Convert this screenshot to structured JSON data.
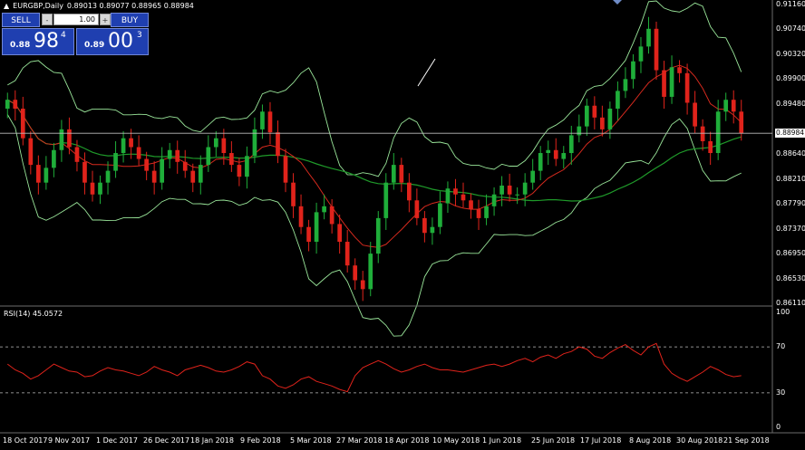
{
  "header": {
    "symbol": "EURGBP,Daily",
    "ohlc": "0.89013 0.89077 0.88965 0.88984"
  },
  "trade_panel": {
    "sell_label": "SELL",
    "buy_label": "BUY",
    "lot_value": "1.00",
    "minus_label": "-",
    "plus_label": "+",
    "sell_quote": {
      "prefix": "0.88",
      "big": "98",
      "sup": "4"
    },
    "buy_quote": {
      "prefix": "0.89",
      "big": "00",
      "sup": "3"
    }
  },
  "current_price": "0.88984",
  "price_axis": [
    "0.91160",
    "0.90740",
    "0.90320",
    "0.89900",
    "0.89480",
    "0.88640",
    "0.88210",
    "0.87790",
    "0.87370",
    "0.86950",
    "0.86530",
    "0.86110"
  ],
  "rsi": {
    "title": "RSI(14) 45.0572",
    "axis": [
      "100",
      "70",
      "30",
      "0"
    ],
    "levels": [
      70,
      30
    ]
  },
  "time_axis": [
    "18 Oct 2017",
    "9 Nov 2017",
    "1 Dec 2017",
    "26 Dec 2017",
    "18 Jan 2018",
    "9 Feb 2018",
    "5 Mar 2018",
    "27 Mar 2018",
    "18 Apr 2018",
    "10 May 2018",
    "1 Jun 2018",
    "25 Jun 2018",
    "17 Jul 2018",
    "8 Aug 2018",
    "30 Aug 2018",
    "21 Sep 2018"
  ],
  "colors": {
    "background": "#000000",
    "bull_candle": "#1fae3a",
    "bear_candle": "#e0231b",
    "bands": "#9ae69a",
    "ma_slow": "#1f9b2a",
    "ma_fast": "#d62a1e",
    "rsi_line": "#e0231b",
    "grid_line": "#bdbdbd"
  },
  "chart_data": {
    "type": "line",
    "title": "EURGBP,Daily",
    "ylim": [
      0.8611,
      0.9116
    ],
    "series": [
      {
        "name": "EURGBP",
        "values": [
          0.8955,
          0.894,
          0.889,
          0.8845,
          0.8815,
          0.884,
          0.887,
          0.8905,
          0.8875,
          0.885,
          0.8815,
          0.8795,
          0.8815,
          0.8835,
          0.8865,
          0.889,
          0.8875,
          0.8855,
          0.8835,
          0.8815,
          0.8855,
          0.887,
          0.885,
          0.8835,
          0.8815,
          0.8845,
          0.8875,
          0.889,
          0.8865,
          0.8845,
          0.8825,
          0.886,
          0.8905,
          0.8935,
          0.89,
          0.886,
          0.8815,
          0.8775,
          0.874,
          0.8715,
          0.8765,
          0.8775,
          0.8745,
          0.8715,
          0.8675,
          0.865,
          0.8635,
          0.8695,
          0.8755,
          0.8815,
          0.8845,
          0.8815,
          0.8785,
          0.8755,
          0.873,
          0.874,
          0.878,
          0.8805,
          0.8795,
          0.8785,
          0.877,
          0.8755,
          0.8775,
          0.8795,
          0.881,
          0.8795,
          0.8795,
          0.8815,
          0.8835,
          0.8865,
          0.887,
          0.8855,
          0.8865,
          0.8895,
          0.891,
          0.8945,
          0.8925,
          0.8905,
          0.894,
          0.897,
          0.899,
          0.902,
          0.9045,
          0.9075,
          0.9005,
          0.896,
          0.901,
          0.9,
          0.895,
          0.891,
          0.8885,
          0.8865,
          0.8935,
          0.8955,
          0.8935,
          0.8898
        ]
      },
      {
        "name": "RSI(14)",
        "values": [
          55,
          50,
          47,
          42,
          45,
          50,
          55,
          52,
          49,
          48,
          44,
          45,
          49,
          52,
          50,
          49,
          47,
          45,
          48,
          53,
          50,
          48,
          45,
          50,
          52,
          54,
          52,
          49,
          48,
          50,
          53,
          57,
          55,
          45,
          42,
          36,
          34,
          37,
          42,
          44,
          40,
          38,
          36,
          33,
          31,
          45,
          52,
          55,
          58,
          55,
          51,
          48,
          50,
          53,
          55,
          52,
          50,
          50,
          49,
          48,
          50,
          52,
          54,
          55,
          53,
          55,
          58,
          60,
          57,
          61,
          63,
          60,
          64,
          66,
          70,
          68,
          62,
          60,
          65,
          69,
          72,
          67,
          63,
          70,
          73,
          55,
          47,
          43,
          40,
          44,
          48,
          53,
          50,
          46,
          44,
          45
        ]
      }
    ]
  }
}
